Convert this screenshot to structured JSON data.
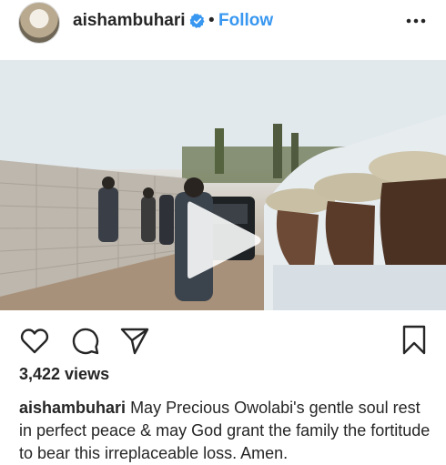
{
  "post": {
    "username": "aishambuhari",
    "separator": "•",
    "follow_label": "Follow",
    "views": "3,422 views",
    "caption_user": "aishambuhari",
    "caption_text": "May Precious Owolabi's gentle soul rest in perfect peace & may God grant the family the fortitude to bear this irreplaceable loss. Amen."
  },
  "icons": {
    "verified": "verified-badge-icon",
    "more": "more-options-icon",
    "play": "play-icon",
    "like": "heart-icon",
    "comment": "comment-bubble-icon",
    "share": "paper-plane-icon",
    "save": "bookmark-icon"
  },
  "colors": {
    "accent": "#3897f0",
    "text": "#262626"
  }
}
